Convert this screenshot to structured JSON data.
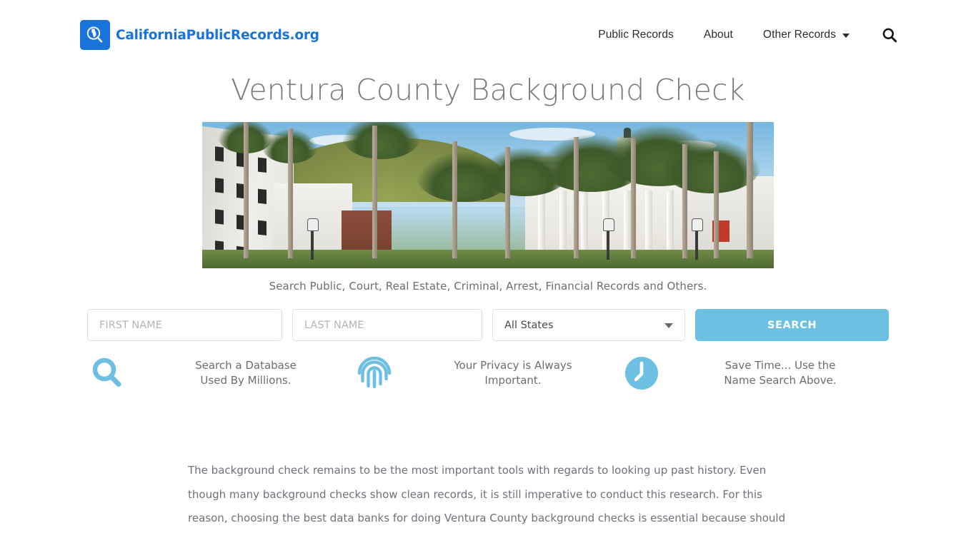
{
  "header": {
    "brand": {
      "icon": "magnifier-california-icon",
      "name": "CaliforniaPublicRecords.org",
      "color": "#1a73d8"
    },
    "nav": [
      {
        "label": "Public Records",
        "has_dropdown": false
      },
      {
        "label": "About",
        "has_dropdown": false
      },
      {
        "label": "Other Records",
        "has_dropdown": true
      }
    ],
    "search_icon": "search-icon"
  },
  "hero": {
    "title": "Ventura County Background Check",
    "image_alt": "Ventura City Hall with palm trees",
    "subtitle": "Search Public, Court, Real Estate, Criminal, Arrest, Financial Records and Others."
  },
  "search_form": {
    "first_name": {
      "placeholder": "FIRST NAME",
      "value": ""
    },
    "last_name": {
      "placeholder": "LAST NAME",
      "value": ""
    },
    "state": {
      "selected": "All States",
      "options": [
        "All States"
      ]
    },
    "submit_label": "SEARCH",
    "submit_color": "#6ec0e2"
  },
  "features": [
    {
      "icon": "search-icon",
      "line1": "Search a Database",
      "line2": "Used By Millions."
    },
    {
      "icon": "fingerprint-icon",
      "line1": "Your Privacy is Always",
      "line2": "Important."
    },
    {
      "icon": "clock-icon",
      "line1": "Save Time... Use the",
      "line2": "Name Search Above."
    }
  ],
  "article": {
    "paragraph": "The background check remains to be the most important tools with regards to looking up past history. Even though many background checks show clean records, it is still imperative to conduct this research. For this reason, choosing the best data banks for doing Ventura County background checks is essential because should"
  },
  "colors": {
    "accent_blue": "#6ec0e2",
    "brand_blue": "#1a73d8",
    "text_gray": "#70707a",
    "title_gray": "#7a7a7a"
  }
}
